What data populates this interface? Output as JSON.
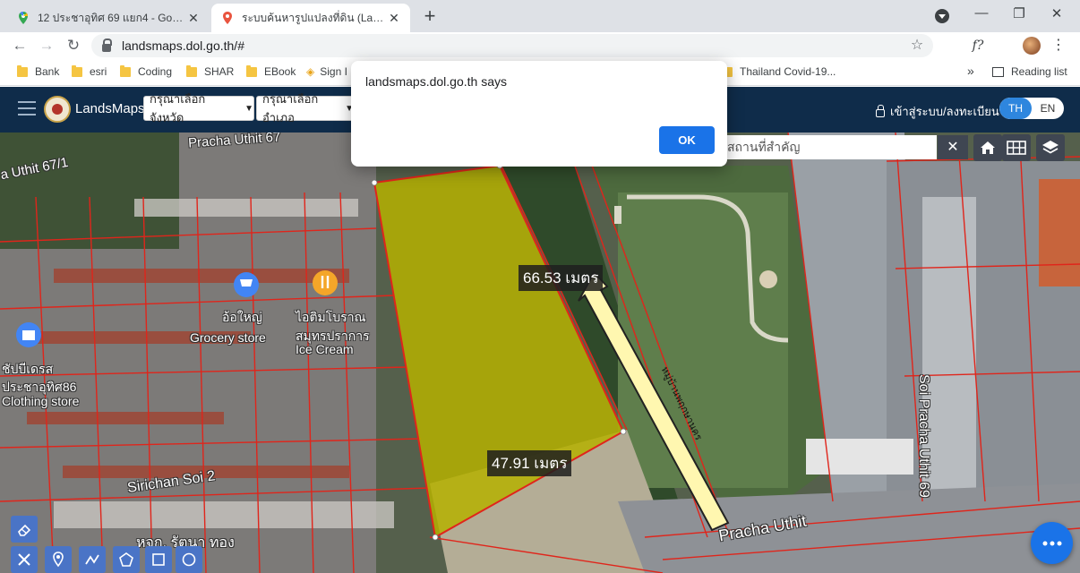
{
  "browser": {
    "tabs": [
      {
        "title": "12 ประชาอุทิศ 69 แยก4 - Google M",
        "active": false
      },
      {
        "title": "ระบบค้นหารูปแปลงที่ดิน (LandsMaps",
        "active": true
      }
    ],
    "new_tab_symbol": "+",
    "close_symbol": "✕",
    "url": "landsmaps.dol.go.th/#",
    "bookmarks": [
      "Bank",
      "esri",
      "Coding",
      "SHAR",
      "EBook",
      "Sign I",
      "Thailand Covid-19..."
    ],
    "bookmarks_overflow": "»",
    "reading_list": "Reading list"
  },
  "app": {
    "brand": "LandsMaps",
    "province_select": "กรุณาเลือกจังหวัด",
    "district_select": "กรุณาเลือกอำเภอ",
    "login_label": "เข้าสู่ระบบ/ลงทะเบียน",
    "lang": {
      "th": "TH",
      "en": "EN",
      "selected": "TH"
    },
    "search_placeholder": "สถานที่สำคัญ"
  },
  "map": {
    "measurements": {
      "top": "66.53 เมตร",
      "bottom": "47.91 เมตร"
    },
    "road_labels": {
      "pracha_uthit_67": "Pracha Uthit 67",
      "pracha_uthit_67_1": "a Uthit 67/1",
      "sirichan_soi_2": "Sirichan Soi 2",
      "pracha_uthit": "Pracha Uthit",
      "soi_pracha_uthit_69": "Soi Pracha Uthit 69"
    },
    "poi_labels": {
      "grocery_th": "อ้อใหญ่",
      "grocery_en": "Grocery store",
      "icecream_th": "ไอติมโบราณ",
      "icecream_th2": "สมุทรปราการ",
      "icecream_en": "Ice Cream",
      "clothing_th1": "ชัปบีเดรส",
      "clothing_th2": "ประชาอุทิศ86",
      "clothing_en": "Clothing store",
      "bottom_th": "หจก. รัตนา ทอง"
    },
    "arrow_label": "หมู่บ้านพฤกษานคร",
    "colors": {
      "parcel_fill": "#b5b000",
      "parcel_line": "#e0251b",
      "arrow_fill": "#fff7b0"
    }
  },
  "dialog": {
    "title": "landsmaps.dol.go.th says",
    "ok_label": "OK"
  }
}
